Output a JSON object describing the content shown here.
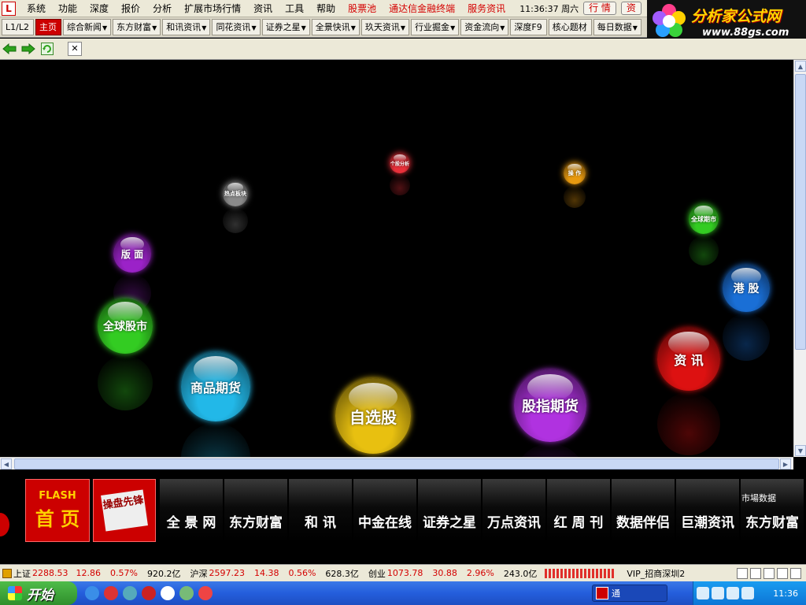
{
  "menu": {
    "items": [
      "系统",
      "功能",
      "深度",
      "报价",
      "分析",
      "扩展市场行情",
      "资讯",
      "工具",
      "帮助"
    ],
    "highlight_items": [
      "股票池",
      "通达信金融终端",
      "服务资讯"
    ],
    "time": "11:36:37 周六",
    "quote_button": "行 情",
    "info_button": "资"
  },
  "logo": {
    "title": "分析家公式网",
    "url": "www.88gs.com"
  },
  "tabs": [
    {
      "label": "L1/L2",
      "arrow": ""
    },
    {
      "label": "主页",
      "arrow": ""
    },
    {
      "label": "综合新闻",
      "arrow": "▼"
    },
    {
      "label": "东方财富",
      "arrow": "▼"
    },
    {
      "label": "和讯资讯",
      "arrow": "▼"
    },
    {
      "label": "同花资讯",
      "arrow": "▼"
    },
    {
      "label": "证券之星",
      "arrow": "▼"
    },
    {
      "label": "全景快讯",
      "arrow": "▼"
    },
    {
      "label": "玖天资讯",
      "arrow": "▼"
    },
    {
      "label": "行业掘金",
      "arrow": "▼"
    },
    {
      "label": "资金流向",
      "arrow": "▼"
    },
    {
      "label": "深度F9",
      "arrow": ""
    },
    {
      "label": "核心题材",
      "arrow": ""
    },
    {
      "label": "每日数据",
      "arrow": "▼"
    }
  ],
  "nav": {
    "close_label": "✕"
  },
  "balls": [
    {
      "label": "版 面",
      "color": "#9b22c8"
    },
    {
      "label": "热点板块",
      "color": "#8a8a8a"
    },
    {
      "label": "个股分析",
      "color": "#e8303a"
    },
    {
      "label": "操 作",
      "color": "#e89a10"
    },
    {
      "label": "全球期市",
      "color": "#33cc22"
    },
    {
      "label": "港 股",
      "color": "#1a6fd6"
    },
    {
      "label": "全球股市",
      "color": "#33cc22"
    },
    {
      "label": "资 讯",
      "color": "#dd1111"
    },
    {
      "label": "商品期货",
      "color": "#22b8e8"
    },
    {
      "label": "自选股",
      "color": "#e8c010"
    },
    {
      "label": "股指期货",
      "color": "#b032e0"
    }
  ],
  "banner": {
    "flash_label": "FLASH",
    "home_label": "首 页",
    "caopan_label": "操盘先锋",
    "market_data_label": "市場数据",
    "sites": [
      "全 景 网",
      "东方财富",
      "和 讯",
      "中金在线",
      "证券之星",
      "万点资讯",
      "红 周 刊",
      "数据伴侣",
      "巨潮资讯",
      "东方财富"
    ]
  },
  "status": {
    "sh_name": "上证",
    "sh_value": "2288.53",
    "sh_change": "12.86",
    "sh_pct": "0.57%",
    "sh_vol": "920.2亿",
    "sz_name": "沪深",
    "sz_value": "2597.23",
    "sz_change": "14.38",
    "sz_pct": "0.56%",
    "sz_vol": "628.3亿",
    "cy_name": "创业",
    "cy_value": "1073.78",
    "cy_change": "30.88",
    "cy_pct": "2.96%",
    "cy_vol": "243.0亿",
    "connection": "VIP_招商深圳2"
  },
  "taskbar": {
    "start_label": "开始",
    "task_label": "通",
    "clock": "11:36"
  }
}
